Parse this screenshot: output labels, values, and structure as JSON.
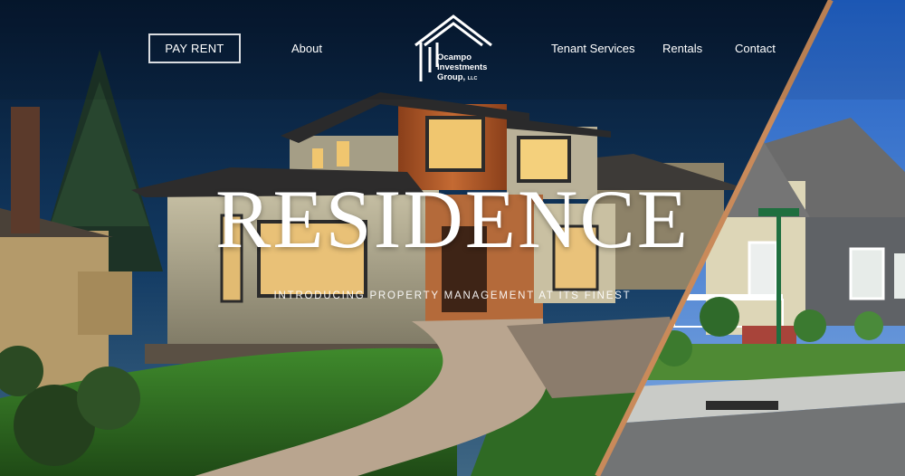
{
  "nav": {
    "pay_rent": "PAY RENT",
    "about": "About",
    "tenant_services": "Tenant Services",
    "rentals": "Rentals",
    "contact": "Contact"
  },
  "logo": {
    "line1": "Ocampo",
    "line2": "Investments",
    "line3": "Group,",
    "llc": "LLC"
  },
  "hero": {
    "headline": "RESIDENCE",
    "tagline": "INTRODUCING PROPERTY MANAGEMENT AT ITS FINEST"
  },
  "colors": {
    "night_sky": "#0b2446",
    "day_sky": "#2a66c8",
    "divider": "#c98a5a",
    "text": "#ffffff"
  }
}
